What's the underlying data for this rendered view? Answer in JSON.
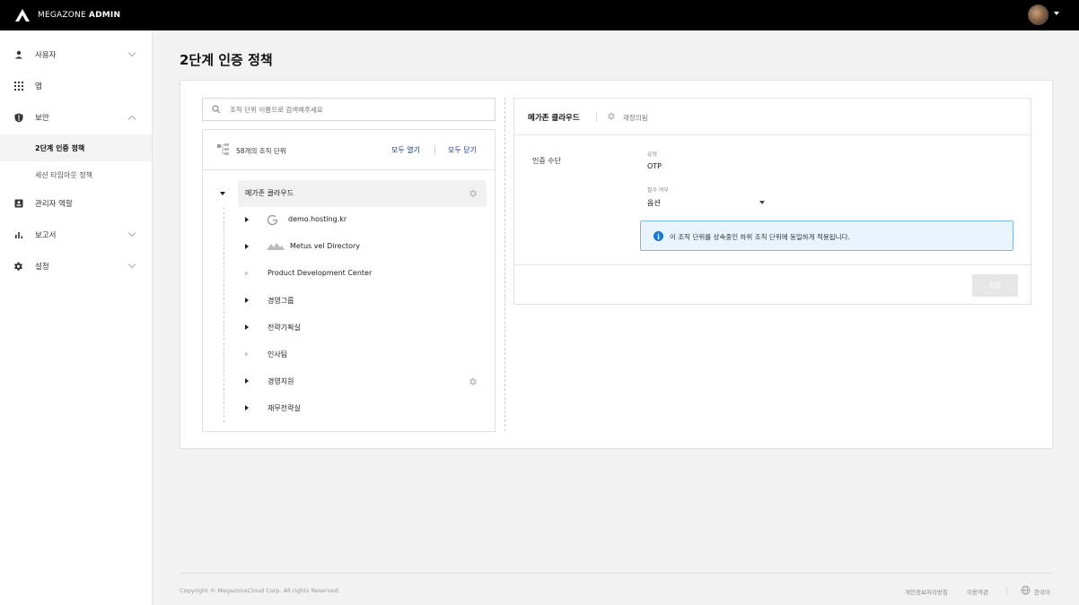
{
  "app": {
    "logo_text_light": "MEGAZONE",
    "logo_text_bold": "ADMIN"
  },
  "sidebar": {
    "items": [
      {
        "label": "사용자",
        "icon": "user-icon"
      },
      {
        "label": "앱",
        "icon": "apps-grid-icon"
      },
      {
        "label": "보안",
        "icon": "shield-icon"
      },
      {
        "label": "관리자 역할",
        "icon": "admin-badge-icon"
      },
      {
        "label": "보고서",
        "icon": "bar-chart-icon"
      },
      {
        "label": "설정",
        "icon": "gear-icon"
      }
    ],
    "security_sub": [
      {
        "label": "2단계 인증 정책",
        "active": true
      },
      {
        "label": "세션 타임아웃 정책",
        "active": false
      }
    ]
  },
  "page": {
    "title": "2단계 인증 정책"
  },
  "search": {
    "placeholder": "조직 단위 이름으로 검색해주세요"
  },
  "tree": {
    "count_label": "58개의 조직 단위",
    "open_all": "모두 열기",
    "close_all": "모두 닫기",
    "root": "메가존 클라우드",
    "children": [
      {
        "label": "demo.hosting.kr",
        "icon": "google-icon",
        "expandable": true
      },
      {
        "label": "Metus vel Directory",
        "icon": "mountain-icon",
        "expandable": true
      },
      {
        "label": "Product Development Center",
        "expandable": false
      },
      {
        "label": "경영그룹",
        "expandable": true
      },
      {
        "label": "전략기획실",
        "expandable": true
      },
      {
        "label": "인사팀",
        "expandable": false
      },
      {
        "label": "경영지원",
        "expandable": true
      },
      {
        "label": "재무전략실",
        "expandable": true
      }
    ]
  },
  "detail": {
    "title": "메가존 클라우드",
    "reset_label": "재정의됨",
    "auth_method_label": "인증 수단",
    "type_label": "유형",
    "type_value": "OTP",
    "required_label": "필수 여부",
    "required_value": "옵션",
    "info_text": "이 조직 단위를 상속중인 하위 조직 단위에 동일하게 적용됩니다.",
    "save_label": "저장"
  },
  "footer": {
    "copyright": "Copyright © MegazoneCloud Corp. All rights Reserved.",
    "privacy": "개인정보처리방침",
    "terms": "이용약관",
    "language": "한국어"
  },
  "colors": {
    "topbar": "#000000",
    "link": "#1a3b8a",
    "info_bg": "#eaf4ff",
    "info_border": "#7fb6e8",
    "info_icon": "#1976d2"
  }
}
